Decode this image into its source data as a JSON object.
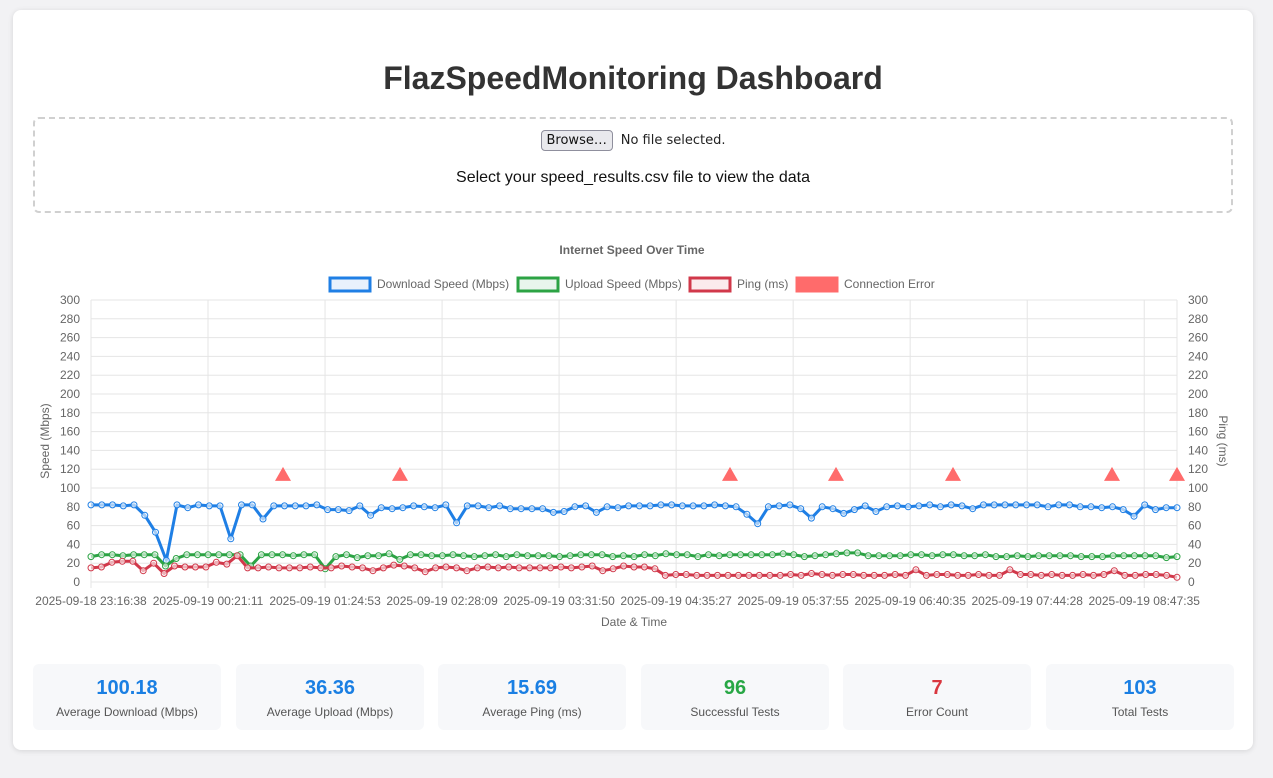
{
  "page": {
    "title": "FlazSpeedMonitoring Dashboard"
  },
  "upload": {
    "browse_label": "Browse…",
    "file_status": "No file selected.",
    "instruction": "Select your speed_results.csv file to view the data"
  },
  "colors": {
    "download": "#1f7fe5",
    "upload": "#2ca344",
    "ping": "#d1384a",
    "error": "#ff6b6b",
    "stat_blue": "#1a7fe3",
    "stat_green": "#28a745",
    "stat_red": "#d9373f"
  },
  "chart_data": {
    "type": "line",
    "title": "Internet Speed Over Time",
    "xlabel": "Date & Time",
    "ylabel": "Speed (Mbps)",
    "y2label": "Ping (ms)",
    "ylim": [
      0,
      300
    ],
    "y2lim": [
      0,
      300
    ],
    "yticks": [
      0,
      20,
      40,
      60,
      80,
      100,
      120,
      140,
      160,
      180,
      200,
      220,
      240,
      260,
      280,
      300
    ],
    "grid": true,
    "legend_position": "top",
    "legend": [
      "Download Speed (Mbps)",
      "Upload Speed (Mbps)",
      "Ping (ms)",
      "Connection Error"
    ],
    "x_tick_labels": [
      "2025-09-18 23:16:38",
      "2025-09-19 00:21:11",
      "2025-09-19 01:24:53",
      "2025-09-19 02:28:09",
      "2025-09-19 03:31:50",
      "2025-09-19 04:35:27",
      "2025-09-19 05:37:55",
      "2025-09-19 06:40:35",
      "2025-09-19 07:44:28",
      "2025-09-19 08:47:35"
    ],
    "series": [
      {
        "name": "Download Speed (Mbps)",
        "values": [
          82,
          82,
          82,
          81,
          82,
          71,
          53,
          23,
          82,
          79,
          82,
          81,
          81,
          46,
          82,
          82,
          67,
          81,
          81,
          81,
          81,
          82,
          77,
          77,
          76,
          81,
          71,
          79,
          78,
          79,
          81,
          80,
          79,
          82,
          63,
          81,
          81,
          79,
          81,
          78,
          78,
          78,
          78,
          74,
          75,
          80,
          81,
          74,
          80,
          79,
          81,
          81,
          81,
          82,
          82,
          81,
          81,
          81,
          82,
          81,
          80,
          72,
          62,
          80,
          81,
          82,
          78,
          68,
          80,
          78,
          73,
          77,
          81,
          75,
          80,
          81,
          80,
          81,
          82,
          80,
          82,
          81,
          78,
          82,
          82,
          82,
          82,
          82,
          82,
          80,
          82,
          82,
          80,
          80,
          79,
          80,
          77,
          70,
          82,
          77,
          79,
          79
        ]
      },
      {
        "name": "Upload Speed (Mbps)",
        "values": [
          27,
          29,
          29,
          28,
          29,
          29,
          29,
          17,
          25,
          29,
          29,
          29,
          29,
          29,
          29,
          17,
          29,
          29,
          29,
          28,
          29,
          29,
          14,
          27,
          29,
          26,
          28,
          28,
          30,
          24,
          29,
          29,
          28,
          28,
          29,
          28,
          27,
          28,
          29,
          27,
          29,
          28,
          28,
          28,
          27,
          28,
          29,
          29,
          29,
          27,
          28,
          27,
          29,
          28,
          30,
          29,
          29,
          27,
          29,
          28,
          29,
          29,
          29,
          29,
          29,
          30,
          29,
          27,
          28,
          29,
          30,
          31,
          31,
          28,
          28,
          28,
          28,
          29,
          29,
          28,
          29,
          29,
          28,
          28,
          29,
          27,
          27,
          28,
          27,
          28,
          28,
          28,
          28,
          27,
          27,
          27,
          28,
          28,
          28,
          28,
          28,
          26,
          27
        ]
      },
      {
        "name": "Ping (ms)",
        "values": [
          15,
          16,
          21,
          22,
          22,
          12,
          20,
          9,
          17,
          16,
          16,
          16,
          21,
          19,
          28,
          15,
          15,
          16,
          15,
          15,
          15,
          16,
          15,
          15,
          17,
          16,
          15,
          12,
          15,
          18,
          17,
          15,
          11,
          15,
          16,
          15,
          12,
          15,
          16,
          15,
          16,
          15,
          15,
          15,
          15,
          16,
          15,
          16,
          17,
          12,
          14,
          17,
          16,
          16,
          14,
          7,
          8,
          8,
          7,
          7,
          7,
          7,
          7,
          7,
          7,
          7,
          7,
          8,
          7,
          9,
          8,
          7,
          8,
          8,
          7,
          7,
          7,
          8,
          7,
          13,
          7,
          8,
          8,
          7,
          7,
          8,
          7,
          7,
          13,
          8,
          8,
          7,
          8,
          7,
          7,
          8,
          7,
          8,
          12,
          7,
          7,
          8,
          8,
          7,
          5
        ]
      },
      {
        "name": "Connection Error",
        "values": [
          115,
          115,
          115,
          115,
          115,
          115,
          115
        ]
      }
    ]
  },
  "stats": [
    {
      "value": "100.18",
      "label": "Average Download (Mbps)"
    },
    {
      "value": "36.36",
      "label": "Average Upload (Mbps)"
    },
    {
      "value": "15.69",
      "label": "Average Ping (ms)"
    },
    {
      "value": "96",
      "label": "Successful Tests"
    },
    {
      "value": "7",
      "label": "Error Count"
    },
    {
      "value": "103",
      "label": "Total Tests"
    }
  ]
}
